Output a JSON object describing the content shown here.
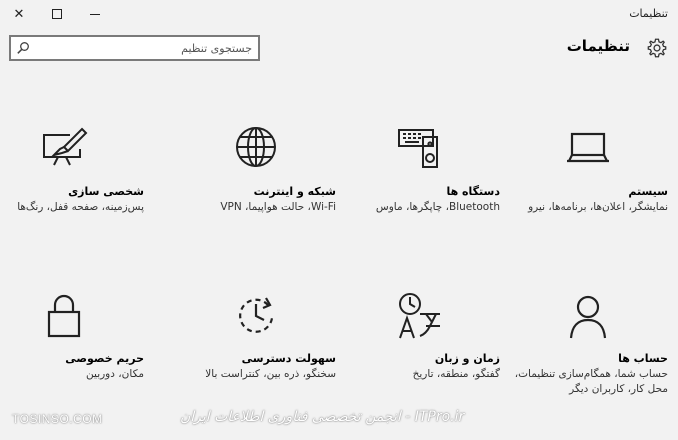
{
  "window": {
    "title": "تنظیمات",
    "close_glyph": "✕",
    "icons": [
      "close-icon",
      "maximize-icon",
      "minimize-icon"
    ]
  },
  "header": {
    "title": "تنظیمات",
    "icon": "gear-icon"
  },
  "search": {
    "placeholder": "جستجوی تنظیم",
    "value": "",
    "icon": "search-icon"
  },
  "tiles": [
    {
      "title": "سیستم",
      "desc": "نمایشگر، اعلان‌ها، برنامه‌ها، نیرو",
      "icon": "laptop-icon"
    },
    {
      "title": "دستگاه ها",
      "desc": "Bluetooth، چاپگرها، ماوس",
      "icon": "devices-icon"
    },
    {
      "title": "شبکه و اینترنت",
      "desc": "Wi-Fi، حالت هواپیما، VPN",
      "icon": "globe-icon"
    },
    {
      "title": "شخصی سازی",
      "desc": "پس‌زمینه، صفحه قفل، رنگ‌ها",
      "icon": "personalization-icon"
    },
    {
      "title": "حساب ها",
      "desc": "حساب شما، همگام‌سازی تنظیمات، محل کار، کاربران دیگر",
      "icon": "person-icon"
    },
    {
      "title": "زمان و زبان",
      "desc": "گفتگو، منطقه، تاریخ",
      "icon": "time-language-icon"
    },
    {
      "title": "سهولت دسترسی",
      "desc": "سخنگو، ذره بین، کنتراست بالا",
      "icon": "ease-of-access-icon"
    },
    {
      "title": "حریم خصوصی",
      "desc": "مکان، دوربین",
      "icon": "lock-icon"
    }
  ],
  "watermark": {
    "left": "TOSINSO.COM",
    "right": "ITPro.ir - انجمن تخصصی فناوری اطلاعات ایران"
  }
}
